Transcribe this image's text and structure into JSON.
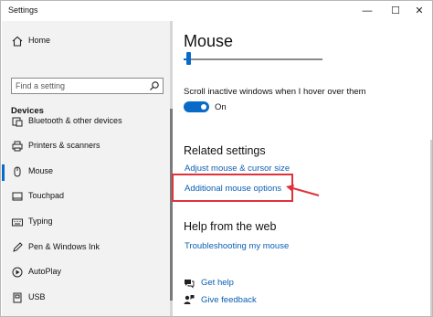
{
  "window": {
    "title": "Settings",
    "controls": {
      "minimize": "—",
      "maximize": "☐",
      "close": "✕"
    }
  },
  "sidebar": {
    "home_label": "Home",
    "search_placeholder": "Find a setting",
    "section_title": "Devices",
    "items": [
      {
        "label": "Bluetooth & other devices",
        "icon": "bluetooth-icon"
      },
      {
        "label": "Printers & scanners",
        "icon": "printer-icon"
      },
      {
        "label": "Mouse",
        "icon": "mouse-icon",
        "active": true
      },
      {
        "label": "Touchpad",
        "icon": "touchpad-icon"
      },
      {
        "label": "Typing",
        "icon": "keyboard-icon"
      },
      {
        "label": "Pen & Windows Ink",
        "icon": "pen-icon"
      },
      {
        "label": "AutoPlay",
        "icon": "autoplay-icon"
      },
      {
        "label": "USB",
        "icon": "usb-icon"
      }
    ]
  },
  "main": {
    "title": "Mouse",
    "scroll_inactive_label": "Scroll inactive windows when I hover over them",
    "scroll_inactive_state": "On",
    "related_heading": "Related settings",
    "related_links": [
      "Adjust mouse & cursor size",
      "Additional mouse options"
    ],
    "help_heading": "Help from the web",
    "help_links": [
      "Troubleshooting my mouse"
    ],
    "get_help": "Get help",
    "give_feedback": "Give feedback"
  },
  "colors": {
    "accent": "#0a6ac7",
    "link": "#0a5fb4",
    "annotation": "#e0323a"
  }
}
